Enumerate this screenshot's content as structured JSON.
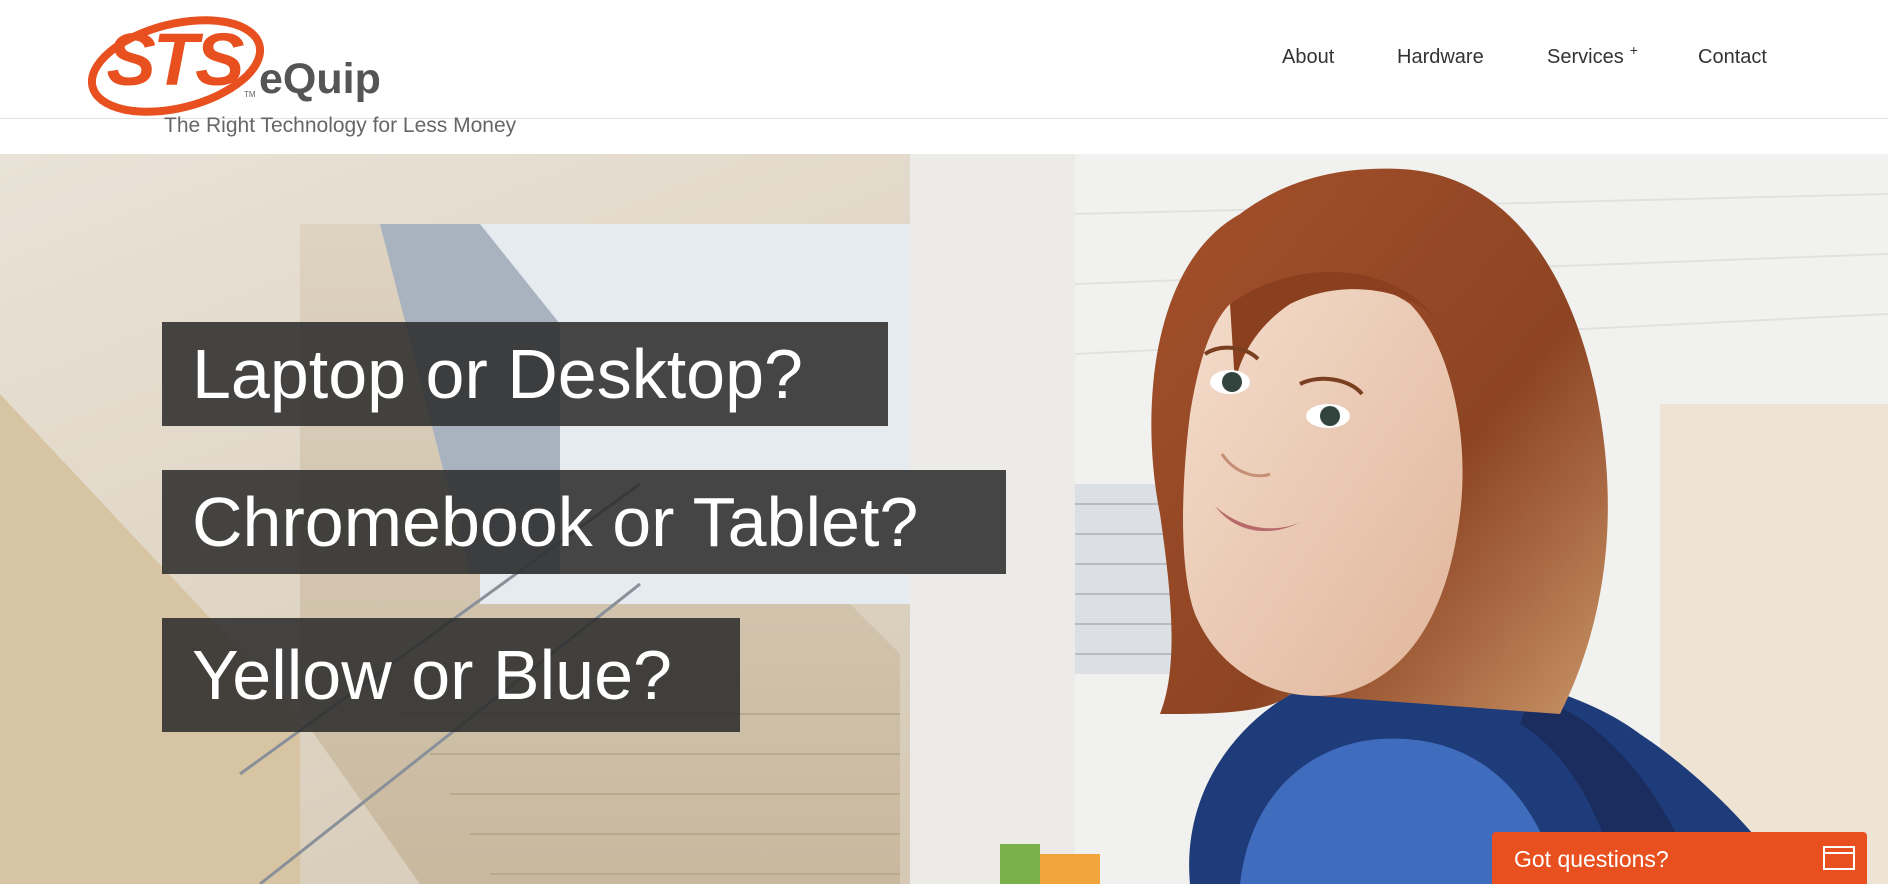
{
  "header": {
    "logo": {
      "brand_text": "STS",
      "sub_text": "eQuip",
      "tagline": "The Right Technology for Less Money",
      "brand_color": "#e8501f"
    },
    "nav": [
      {
        "label": "About"
      },
      {
        "label": "Hardware"
      },
      {
        "label": "Services",
        "has_submenu_indicator": "+"
      },
      {
        "label": "Contact"
      }
    ]
  },
  "hero": {
    "headlines": [
      "Laptop or Desktop?",
      "Chromebook or Tablet?",
      "Yellow or Blue?"
    ],
    "headline_box_color": "#2a2a2a"
  },
  "chat_widget": {
    "label": "Got questions?",
    "icon": "chat-window-icon",
    "color": "#e8501f"
  }
}
